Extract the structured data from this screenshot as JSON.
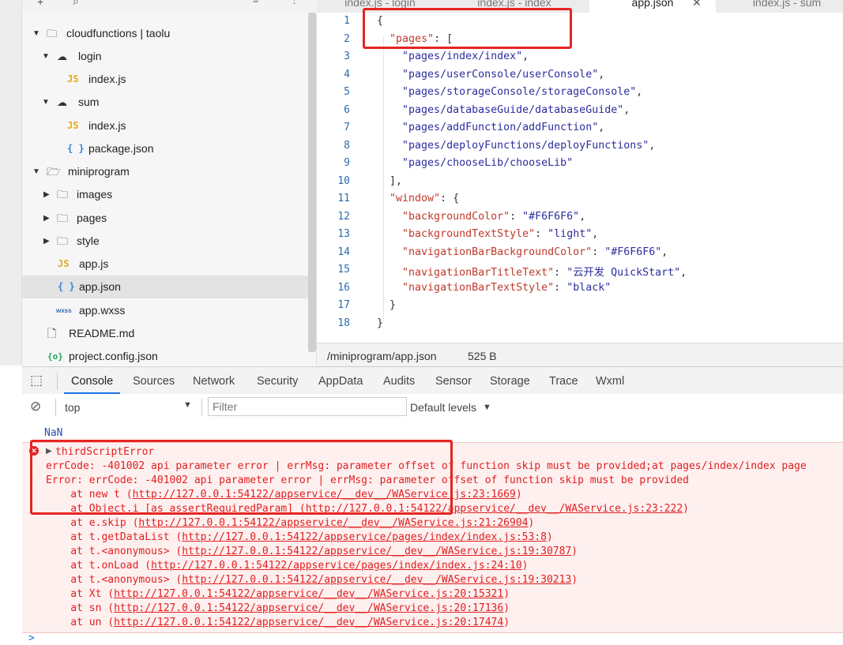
{
  "tabs": [
    {
      "label": "index.js - login",
      "active": false
    },
    {
      "label": "index.js - index",
      "active": false
    },
    {
      "label": "app.json",
      "active": true
    },
    {
      "label": "index.js - sum",
      "active": false
    }
  ],
  "tree": {
    "root_label": "cloudfunctions | taolu",
    "items": [
      {
        "label": "login"
      },
      {
        "label": "index.js"
      },
      {
        "label": "sum"
      },
      {
        "label": "index.js"
      },
      {
        "label": "package.json"
      },
      {
        "label": "miniprogram"
      },
      {
        "label": "images"
      },
      {
        "label": "pages"
      },
      {
        "label": "style"
      },
      {
        "label": "app.js"
      },
      {
        "label": "app.json"
      },
      {
        "label": "app.wxss"
      },
      {
        "label": "README.md"
      },
      {
        "label": "project.config.json"
      }
    ],
    "icon_text": {
      "js": "JS",
      "json": "{ }",
      "wxss": "wxss",
      "cfg": "{o}"
    }
  },
  "editor": {
    "line_numbers": [
      "1",
      "2",
      "3",
      "4",
      "5",
      "6",
      "7",
      "8",
      "9",
      "10",
      "11",
      "12",
      "13",
      "14",
      "15",
      "16",
      "17",
      "18"
    ],
    "lines": [
      {
        "parts": [
          {
            "t": "{",
            "c": ""
          }
        ]
      },
      {
        "parts": [
          {
            "t": "  ",
            "c": ""
          },
          {
            "t": "\"pages\"",
            "c": "k"
          },
          {
            "t": ": [",
            "c": ""
          }
        ]
      },
      {
        "parts": [
          {
            "t": "    ",
            "c": ""
          },
          {
            "t": "\"pages/index/index\"",
            "c": "s"
          },
          {
            "t": ",",
            "c": ""
          }
        ]
      },
      {
        "parts": [
          {
            "t": "    ",
            "c": ""
          },
          {
            "t": "\"pages/userConsole/userConsole\"",
            "c": "s"
          },
          {
            "t": ",",
            "c": ""
          }
        ]
      },
      {
        "parts": [
          {
            "t": "    ",
            "c": ""
          },
          {
            "t": "\"pages/storageConsole/storageConsole\"",
            "c": "s"
          },
          {
            "t": ",",
            "c": ""
          }
        ]
      },
      {
        "parts": [
          {
            "t": "    ",
            "c": ""
          },
          {
            "t": "\"pages/databaseGuide/databaseGuide\"",
            "c": "s"
          },
          {
            "t": ",",
            "c": ""
          }
        ]
      },
      {
        "parts": [
          {
            "t": "    ",
            "c": ""
          },
          {
            "t": "\"pages/addFunction/addFunction\"",
            "c": "s"
          },
          {
            "t": ",",
            "c": ""
          }
        ]
      },
      {
        "parts": [
          {
            "t": "    ",
            "c": ""
          },
          {
            "t": "\"pages/deployFunctions/deployFunctions\"",
            "c": "s"
          },
          {
            "t": ",",
            "c": ""
          }
        ]
      },
      {
        "parts": [
          {
            "t": "    ",
            "c": ""
          },
          {
            "t": "\"pages/chooseLib/chooseLib\"",
            "c": "s"
          }
        ]
      },
      {
        "parts": [
          {
            "t": "  ],",
            "c": ""
          }
        ]
      },
      {
        "parts": [
          {
            "t": "  ",
            "c": ""
          },
          {
            "t": "\"window\"",
            "c": "k"
          },
          {
            "t": ": {",
            "c": ""
          }
        ]
      },
      {
        "parts": [
          {
            "t": "    ",
            "c": ""
          },
          {
            "t": "\"backgroundColor\"",
            "c": "k"
          },
          {
            "t": ": ",
            "c": ""
          },
          {
            "t": "\"#F6F6F6\"",
            "c": "s"
          },
          {
            "t": ",",
            "c": ""
          }
        ]
      },
      {
        "parts": [
          {
            "t": "    ",
            "c": ""
          },
          {
            "t": "\"backgroundTextStyle\"",
            "c": "k"
          },
          {
            "t": ": ",
            "c": ""
          },
          {
            "t": "\"light\"",
            "c": "s"
          },
          {
            "t": ",",
            "c": ""
          }
        ]
      },
      {
        "parts": [
          {
            "t": "    ",
            "c": ""
          },
          {
            "t": "\"navigationBarBackgroundColor\"",
            "c": "k"
          },
          {
            "t": ": ",
            "c": ""
          },
          {
            "t": "\"#F6F6F6\"",
            "c": "s"
          },
          {
            "t": ",",
            "c": ""
          }
        ]
      },
      {
        "parts": [
          {
            "t": "    ",
            "c": ""
          },
          {
            "t": "\"navigationBarTitleText\"",
            "c": "k"
          },
          {
            "t": ": ",
            "c": ""
          },
          {
            "t": "\"云开发 QuickStart\"",
            "c": "s"
          },
          {
            "t": ",",
            "c": ""
          }
        ]
      },
      {
        "parts": [
          {
            "t": "    ",
            "c": ""
          },
          {
            "t": "\"navigationBarTextStyle\"",
            "c": "k"
          },
          {
            "t": ": ",
            "c": ""
          },
          {
            "t": "\"black\"",
            "c": "s"
          }
        ]
      },
      {
        "parts": [
          {
            "t": "  }",
            "c": ""
          }
        ]
      },
      {
        "parts": [
          {
            "t": "}",
            "c": ""
          }
        ]
      }
    ]
  },
  "status": {
    "path": "/miniprogram/app.json",
    "size": "525 B"
  },
  "devtools": {
    "tabs": [
      "Console",
      "Sources",
      "Network",
      "Security",
      "AppData",
      "Audits",
      "Sensor",
      "Storage",
      "Trace",
      "Wxml"
    ],
    "active_tab": "Console",
    "context_select": "top",
    "filter_placeholder": "Filter",
    "levels": "Default levels"
  },
  "console": {
    "nan": "NaN",
    "error_title": "thirdScriptError",
    "line1": "errCode: -401002 api parameter error | errMsg: parameter offset of function skip must be provided;at pages/index/index page",
    "line2": "Error: errCode: -401002 api parameter error | errMsg: parameter offset of function skip must be provided",
    "stack": [
      {
        "fn": "    at new t (",
        "url": "http://127.0.0.1:54122/appservice/__dev__/WAService.js:23:1669",
        "end": ")"
      },
      {
        "fn": "    at Object.i [as assertRequiredParam] (",
        "url": "http://127.0.0.1:54122/appservice/__dev__/WAService.js:23:222",
        "end": ")"
      },
      {
        "fn": "    at e.skip (",
        "url": "http://127.0.0.1:54122/appservice/__dev__/WAService.js:21:26904",
        "end": ")"
      },
      {
        "fn": "    at t.getDataList (",
        "url": "http://127.0.0.1:54122/appservice/pages/index/index.js:53:8",
        "end": ")"
      },
      {
        "fn": "    at t.<anonymous> (",
        "url": "http://127.0.0.1:54122/appservice/__dev__/WAService.js:19:30787",
        "end": ")"
      },
      {
        "fn": "    at t.onLoad (",
        "url": "http://127.0.0.1:54122/appservice/pages/index/index.js:24:10",
        "end": ")"
      },
      {
        "fn": "    at t.<anonymous> (",
        "url": "http://127.0.0.1:54122/appservice/__dev__/WAService.js:19:30213",
        "end": ")"
      },
      {
        "fn": "    at Xt (",
        "url": "http://127.0.0.1:54122/appservice/__dev__/WAService.js:20:15321",
        "end": ")"
      },
      {
        "fn": "    at sn (",
        "url": "http://127.0.0.1:54122/appservice/__dev__/WAService.js:20:17136",
        "end": ")"
      },
      {
        "fn": "    at un (",
        "url": "http://127.0.0.1:54122/appservice/__dev__/WAService.js:20:17474",
        "end": ")"
      }
    ],
    "prompt": ">"
  },
  "colors": {
    "error": "#e02020",
    "annotation": "#e52521",
    "accent": "#1a73e8"
  }
}
